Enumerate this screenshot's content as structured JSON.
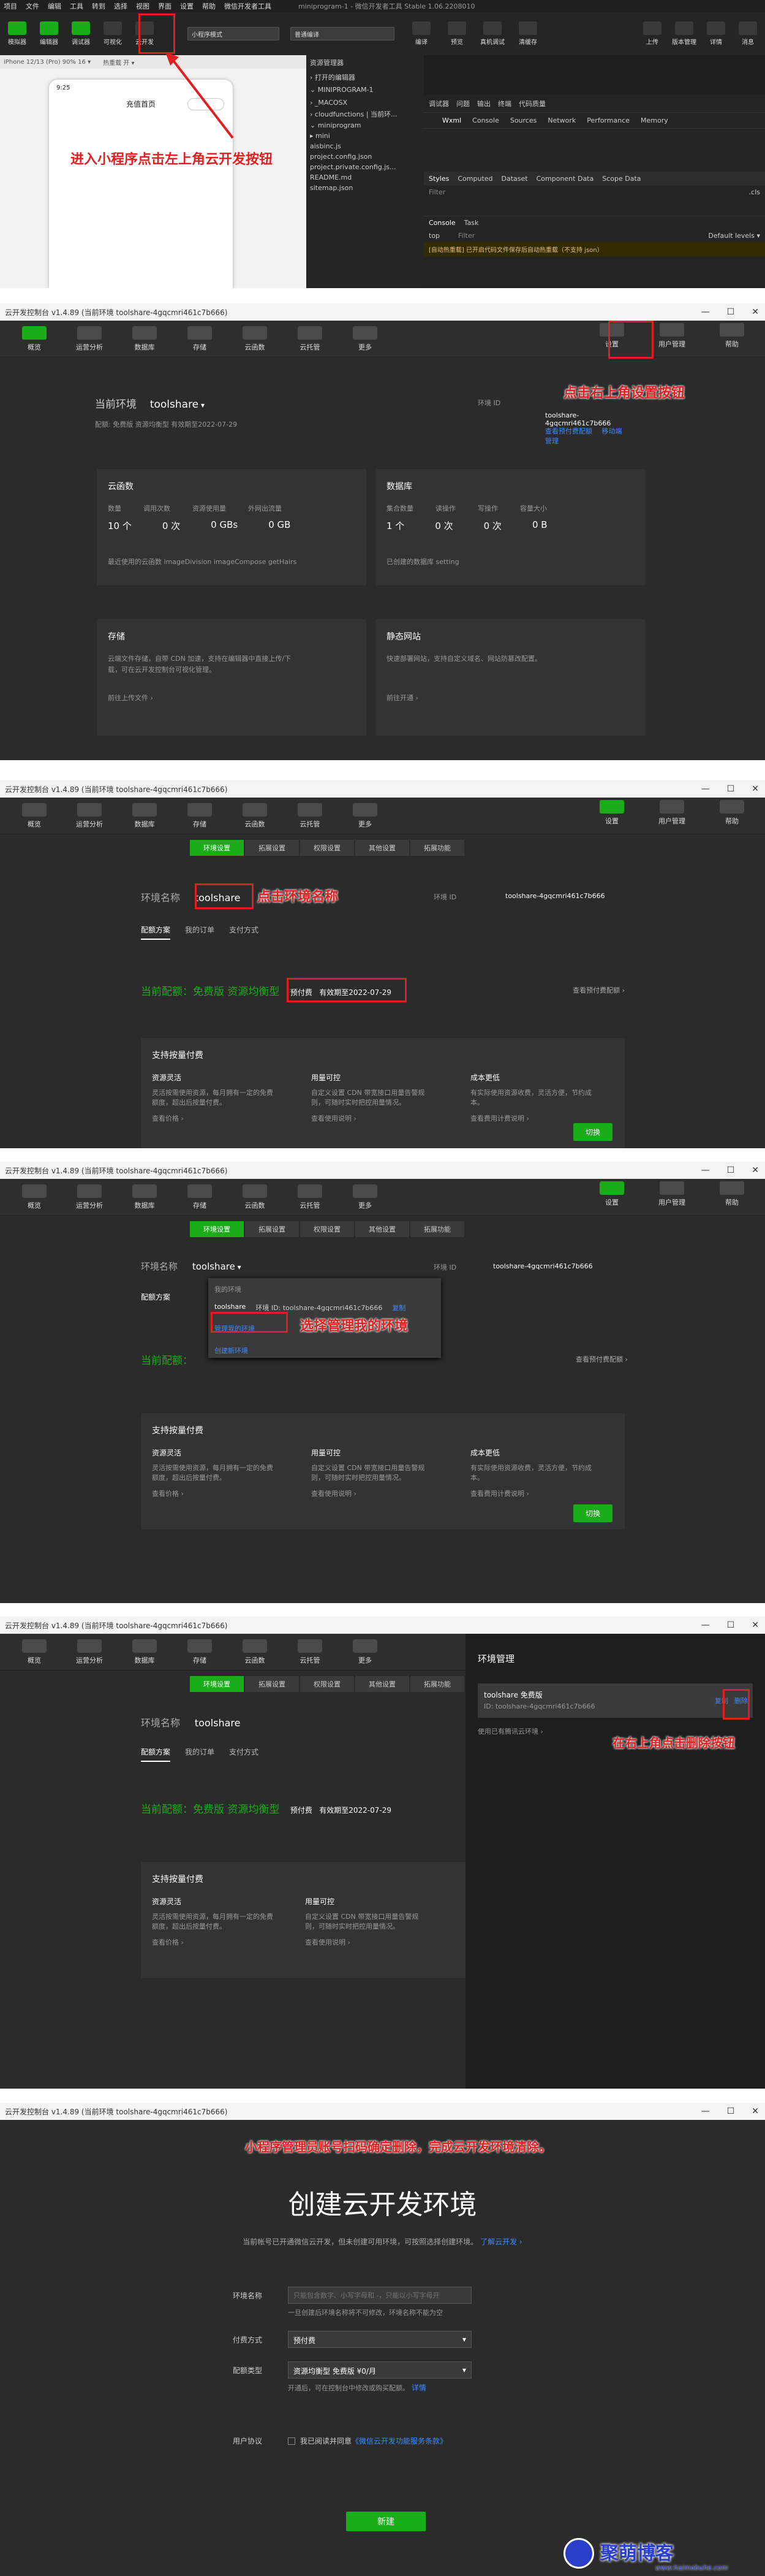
{
  "p1": {
    "menu": [
      "项目",
      "文件",
      "编辑",
      "工具",
      "转到",
      "选择",
      "视图",
      "界面",
      "设置",
      "帮助",
      "微信开发者工具"
    ],
    "project_title": "miniprogram-1 - 微信开发者工具 Stable 1.06.2208010",
    "toolbar": [
      "模拟器",
      "编辑器",
      "调试器",
      "可视化",
      "云开发"
    ],
    "mode_select": "小程序模式",
    "compile_select": "普通编译",
    "right_tools": [
      "编译",
      "预览",
      "真机调试",
      "清缓存"
    ],
    "right_tools2": [
      "上传",
      "版本管理",
      "详情",
      "消息"
    ],
    "device": "iPhone 12/13 (Pro) 90% 16 ▾",
    "hotreload": "热重载 开 ▾",
    "phone_time": "9:25",
    "phone_title": "充值首页",
    "explorer_title": "资源管理器",
    "explorer_open": "› 打开的编辑器",
    "explorer_root": "⌄ MINIPROGRAM-1",
    "files": [
      "› _MACOSX",
      "› cloudfunctions | 当前环...",
      "⌄ miniprogram",
      "  ▸ mini",
      "  sitemap.json",
      "  project.config.json",
      "  project.private.config.js...",
      "  README.md",
      "  aisbinc.js"
    ],
    "devtools_tabs": [
      "调试器",
      "问题",
      "输出",
      "终端",
      "代码质量"
    ],
    "devtools_subtabs": [
      "Wxml",
      "Console",
      "Sources",
      "Network",
      "Performance",
      "Memory"
    ],
    "styles_tabs": [
      "Styles",
      "Computed",
      "Dataset",
      "Component Data",
      "Scope Data"
    ],
    "filter": "Filter",
    "cls": ".cls",
    "console_tabs": [
      "Console",
      "Task"
    ],
    "top": "top",
    "filter2": "Filter",
    "levels": "Default levels ▾",
    "warn": "[自动热重载] 已开启代码文件保存后自动热重载（不支持 json）",
    "annotation": "进入小程序点击左上角云开发按钮"
  },
  "console_common": {
    "title": "云开发控制台 v1.4.89 (当前环境 toolshare-4gqcmri461c7b666)",
    "left_btns": [
      "概览",
      "运营分析",
      "数据库",
      "存储",
      "云函数",
      "云托管",
      "更多"
    ],
    "right_btns": [
      "设置",
      "用户管理",
      "帮助"
    ],
    "settings_tabs": [
      "环境设置",
      "拓展设置",
      "权限设置",
      "其他设置",
      "拓展功能"
    ],
    "env_id_label": "环境 ID",
    "env_id": "toolshare-4gqcmri461c7b666",
    "env_label": "环境名称",
    "env_name": "toolshare",
    "tabs2": [
      "配额方案",
      "我的订单",
      "支付方式"
    ],
    "quota_label": "当前配额：",
    "quota_value": "免费版 资源均衡型",
    "prepaid": "预付费",
    "expire": "有效期至2022-07-29",
    "view_quota": "查看预付费配额 ›",
    "pay_title": "支持按量付费",
    "pay_cols": [
      {
        "h": "资源灵活",
        "t": "灵活按需使用资源，每月拥有一定的免费额度，超出后按量付费。",
        "l": "查看价格 ›"
      },
      {
        "h": "用量可控",
        "t": "自定义设置 CDN 带宽接口用量告警规则，可随时实时把控用量情况。",
        "l": "查看使用说明 ›"
      },
      {
        "h": "成本更低",
        "t": "有实际使用资源收费，灵活方便，节约成本。",
        "l": "查看费用计费说明 ›"
      }
    ],
    "switch_btn": "切换"
  },
  "p2": {
    "cur_env": "当前环境",
    "env_name": "toolshare",
    "env_caret": "▾",
    "env_id_label": "环境 ID",
    "env_id": "toolshare-4gqcmri461c7b666",
    "quota": "配额: 免费版 资源均衡型  有效期至2022-07-29",
    "link1": "查看预付费配额",
    "link2": "移动端管理",
    "cards": [
      {
        "title": "云函数",
        "labels": [
          "数量",
          "调用次数",
          "资源使用量",
          "外网出流量"
        ],
        "values": [
          "10 个",
          "0 次",
          "0 GBs",
          "0 GB"
        ],
        "foot": "最近使用的云函数 imageDivision imageCompose getHairs"
      },
      {
        "title": "数据库",
        "labels": [
          "集合数量",
          "读操作",
          "写操作",
          "容量大小"
        ],
        "values": [
          "1 个",
          "0 次",
          "0 次",
          "0 B"
        ],
        "foot": "已创建的数据库 setting"
      },
      {
        "title": "存储",
        "labels": [],
        "values": [],
        "foot": "云端文件存储，自带 CDN 加速，支持在编辑器中直接上传/下载，可在云开发控制台可视化管理。",
        "link": "前往上传文件 ›"
      },
      {
        "title": "静态网站",
        "labels": [],
        "values": [],
        "foot": "快速部署网站，支持自定义域名、网站防篡改配置。",
        "link": "前往开通 ›"
      }
    ],
    "annotation": "点击右上角设置按钮"
  },
  "p3": {
    "annotation": "点击环境名称"
  },
  "p4": {
    "dd_title": "我的环境",
    "dd_env": "toolshare",
    "dd_env_id": "环境 ID: toolshare-4gqcmri461c7b666",
    "dd_copy": "复制",
    "dd_manage": "管理我的环境",
    "dd_new": "创建新环境",
    "annotation": "选择管理我的环境"
  },
  "p5": {
    "side_title": "环境管理",
    "row_name": "toolshare 免费版",
    "row_id": "ID: toolshare-4gqcmri461c7b666",
    "row_copy": "复制",
    "row_delete": "删除",
    "create_link": "使用已有腾讯云环境 ›",
    "annotation": "在右上角点击删除按钮"
  },
  "p6": {
    "title": "云开发控制台 v1.4.89 (当前环境 toolshare-4gqcmri461c7b666)",
    "top_note": "小程序管理员账号扫码确定删除，完成云开发环境清除。",
    "heading": "创建云开发环境",
    "sub": "当前帐号已开通微信云开发，但未创建可用环境，可按照选择创建环境。",
    "sub_link": "了解云开发 ›",
    "f_env": "环境名称",
    "f_env_ph": "只能包含数字、小写字母和 -，只能以小写字母开",
    "f_env_hint": "一旦创建后环境名称将不可修改，环境名称不能为空",
    "f_pay": "付费方式",
    "f_pay_val": "预付费",
    "f_plan": "配额类型",
    "f_plan_val": "资源均衡型 免费版 ¥0/月",
    "f_plan_note": "开通后，可在控制台中修改或购买配额。",
    "f_plan_link": "详情",
    "f_agree": "用户协议",
    "f_agree_text": "我已阅读并同意",
    "f_agree_link": "《微信云开发功能服务条款》",
    "create_btn": "新建",
    "brand": "聚萌博客",
    "brand_url": "www.haimobuhe.com"
  }
}
